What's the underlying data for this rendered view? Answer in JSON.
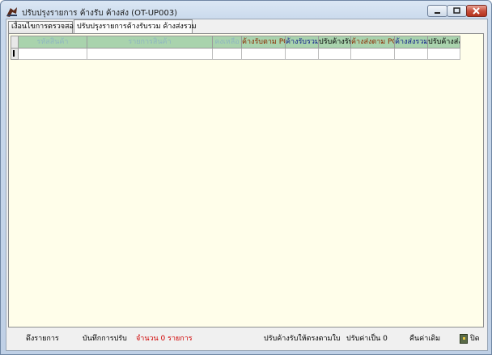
{
  "window": {
    "title": "ปรับปรุงรายการ ค้างรับ ค้างส่ง (OT-UP003)"
  },
  "tabs": [
    {
      "label": "เงื่อนไขการตรวจสอบ"
    },
    {
      "label": "ปรับปรุงรายการค้างรับรวม ค้างส่งรวม"
    }
  ],
  "grid": {
    "columns": [
      {
        "label": "รหัสสินค้า"
      },
      {
        "label": "รายการสินค้า"
      },
      {
        "label": "คงเหลือ"
      },
      {
        "label": "ค้างรับตาม PO"
      },
      {
        "label": "ค้างรับรวม"
      },
      {
        "label": "ปรับค้างรับ"
      },
      {
        "label": "ค้างส่งตาม PO"
      },
      {
        "label": "ค้างส่งรวม"
      },
      {
        "label": "ปรับค้างส่ง"
      }
    ],
    "colors": {
      "header_bg": "#a9d3ad",
      "header_muted_text": "#8fb6c0",
      "po_text": "#8b2a00",
      "total_text": "#0b1a8a",
      "adjust_text": "#000000"
    }
  },
  "footer": {
    "load_items": "ดึงรายการ",
    "save_adjust": "บันทึกการปรับ",
    "count_text": "จำนวน 0 รายการ",
    "adjust_by_doc": "ปรับค้างรับให้ตรงตามใบ",
    "set_zero": "ปรับค่าเป็น 0",
    "restore": "คืนค่าเดิม",
    "close": "ปิด"
  }
}
